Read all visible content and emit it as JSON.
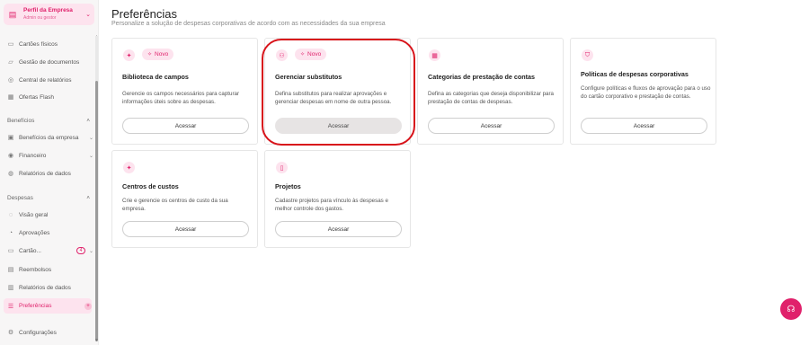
{
  "profile": {
    "name": "Perfil da Empresa",
    "role": "Admin ou gestor"
  },
  "sidebar": {
    "top_items": [
      {
        "label": "Cartões físicos"
      },
      {
        "label": "Gestão de documentos"
      },
      {
        "label": "Central de relatórios"
      },
      {
        "label": "Ofertas Flash"
      }
    ],
    "beneficios": {
      "header": "Benefícios",
      "items": [
        {
          "label": "Benefícios da empresa"
        },
        {
          "label": "Financeiro"
        },
        {
          "label": "Relatórios de dados"
        }
      ]
    },
    "despesas": {
      "header": "Despesas",
      "items": [
        {
          "label": "Visão geral"
        },
        {
          "label": "Aprovações"
        },
        {
          "label": "Cartão...",
          "badge": "4"
        },
        {
          "label": "Reembolsos"
        },
        {
          "label": "Relatórios de dados"
        },
        {
          "label": "Preferências"
        }
      ]
    },
    "footer_item": "Configurações"
  },
  "main": {
    "title": "Preferências",
    "subtitle": "Personalize a solução de despesas corporativas de acordo com as necessidades da sua empresa",
    "cards": [
      {
        "title": "Biblioteca de campos",
        "tag": "Novo",
        "description": "Gerencie os campos necessários para capturar informações úteis sobre as despesas.",
        "button": "Acessar",
        "icon": "megaphone-icon"
      },
      {
        "title": "Gerenciar substitutos",
        "tag": "Novo",
        "description": "Defina substitutos para realizar aprovações e gerenciar despesas em nome de outra pessoa.",
        "button": "Acessar",
        "icon": "users-icon"
      },
      {
        "title": "Categorias de prestação de contas",
        "description": "Defina as categorias que deseja disponibilizar para prestação de contas de despesas.",
        "button": "Acessar",
        "icon": "grid-icon"
      },
      {
        "title": "Políticas de despesas corporativas",
        "description": "Configure políticas e fluxos de aprovação para o uso do cartão corporativo e prestação de contas.",
        "button": "Acessar",
        "icon": "shield-icon"
      },
      {
        "title": "Centros de custos",
        "description": "Crie e gerencie os centros de custo da sua empresa.",
        "button": "Acessar",
        "icon": "megaphone-icon"
      },
      {
        "title": "Projetos",
        "description": "Cadastre projetos para vínculo às despesas e melhor controle dos gastos.",
        "button": "Acessar",
        "icon": "file-icon"
      }
    ]
  },
  "colors": {
    "accent": "#e0216b",
    "accent_light": "#fde3ee",
    "highlight_ring": "#d8141b"
  }
}
